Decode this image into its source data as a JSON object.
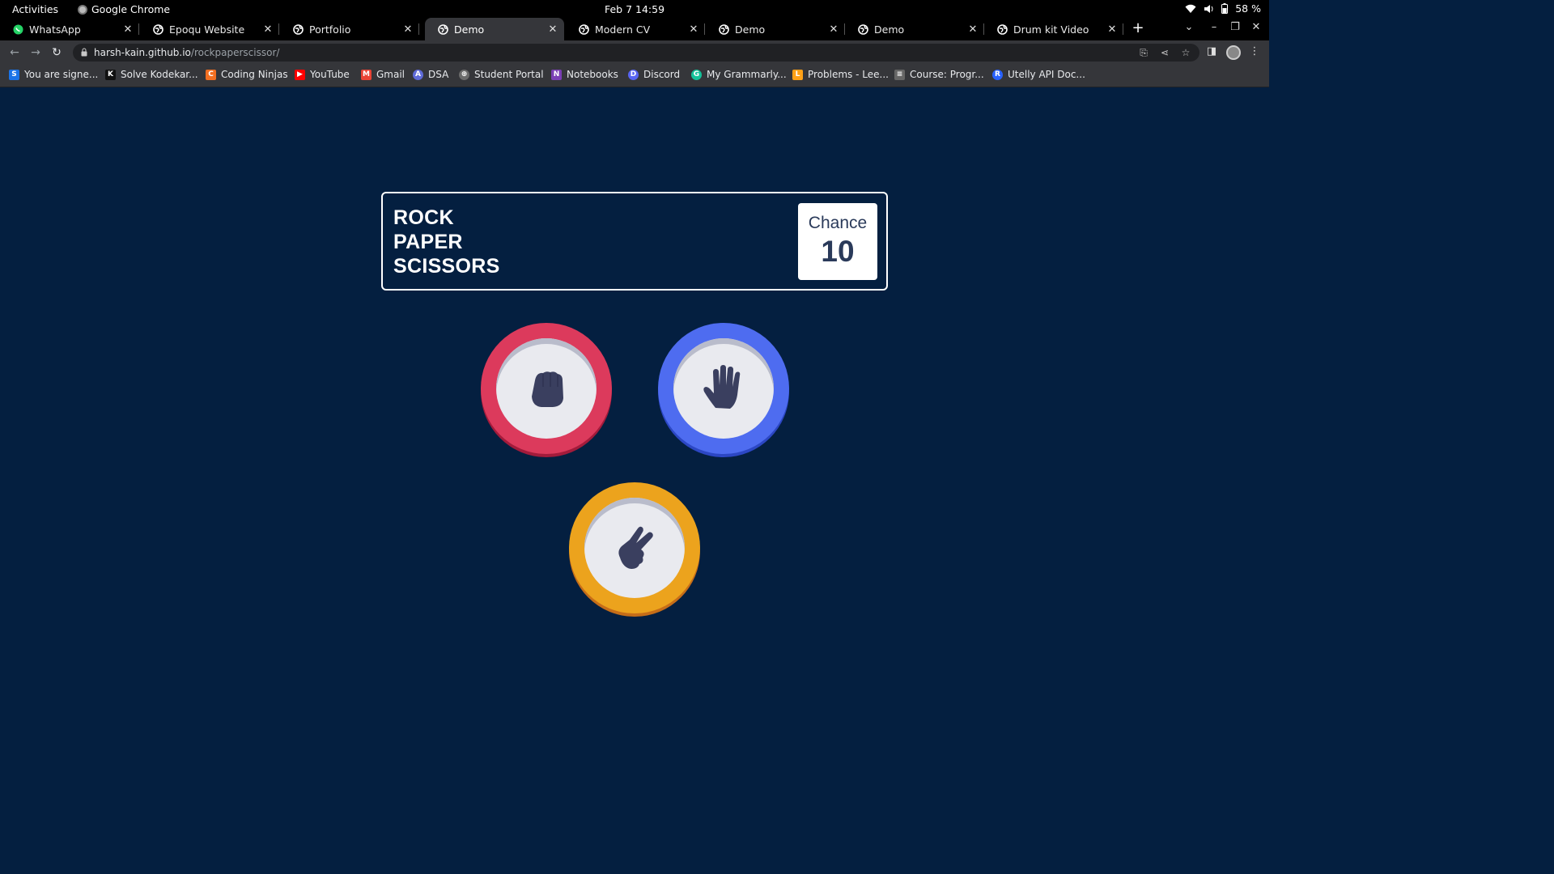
{
  "system_bar": {
    "activities": "Activities",
    "app_name": "Google Chrome",
    "datetime": "Feb 7  14:59",
    "battery": "58 %"
  },
  "tabs": [
    {
      "title": "WhatsApp",
      "icon": "whatsapp-icon",
      "active": false
    },
    {
      "title": "Epoqu Website",
      "icon": "globe-icon",
      "active": false
    },
    {
      "title": "Portfolio",
      "icon": "globe-icon",
      "active": false
    },
    {
      "title": "Demo",
      "icon": "globe-icon",
      "active": true
    },
    {
      "title": "Modern CV",
      "icon": "globe-icon",
      "active": false
    },
    {
      "title": "Demo",
      "icon": "globe-icon",
      "active": false
    },
    {
      "title": "Demo",
      "icon": "globe-icon",
      "active": false
    },
    {
      "title": "Drum kit Video",
      "icon": "globe-icon",
      "active": false
    }
  ],
  "address_bar": {
    "host": "harsh-kain.github.io",
    "path": "/rockpaperscissor/"
  },
  "bookmarks": [
    {
      "label": "You are signe...",
      "icon": "S",
      "color": "#1a73e8"
    },
    {
      "label": "Solve Kodekar...",
      "icon": "K",
      "color": "#111111"
    },
    {
      "label": "Coding Ninjas",
      "icon": "C",
      "color": "#f36f21"
    },
    {
      "label": "YouTube",
      "icon": "▶",
      "color": "#ff0000"
    },
    {
      "label": "Gmail",
      "icon": "M",
      "color": "#ea4335"
    },
    {
      "label": "DSA",
      "icon": "A",
      "color": "#5f6bd8"
    },
    {
      "label": "Student Portal",
      "icon": "⊕",
      "color": "#6b6b6b"
    },
    {
      "label": "Notebooks",
      "icon": "N",
      "color": "#7b3fb5"
    },
    {
      "label": "Discord",
      "icon": "D",
      "color": "#5865f2"
    },
    {
      "label": "My Grammarly...",
      "icon": "G",
      "color": "#15c39a"
    },
    {
      "label": "Problems - Lee...",
      "icon": "L",
      "color": "#ffa116"
    },
    {
      "label": "Course: Progr...",
      "icon": "≡",
      "color": "#666666"
    },
    {
      "label": "Utelly API Doc...",
      "icon": "R",
      "color": "#2962ff"
    }
  ],
  "game": {
    "title_lines": [
      "ROCK",
      "PAPER",
      "SCISSORS"
    ],
    "score_label": "Chance",
    "score_value": "10",
    "choices": [
      {
        "name": "rock",
        "icon": "fist-icon",
        "color": "#dc3a5c",
        "shadow": "#a31b3b"
      },
      {
        "name": "paper",
        "icon": "open-hand-icon",
        "color": "#4e6cf0",
        "shadow": "#2c47c4"
      },
      {
        "name": "scissors",
        "icon": "scissors-hand-icon",
        "color": "#eca31d",
        "shadow": "#c66d18"
      }
    ],
    "background": "#041f40"
  }
}
